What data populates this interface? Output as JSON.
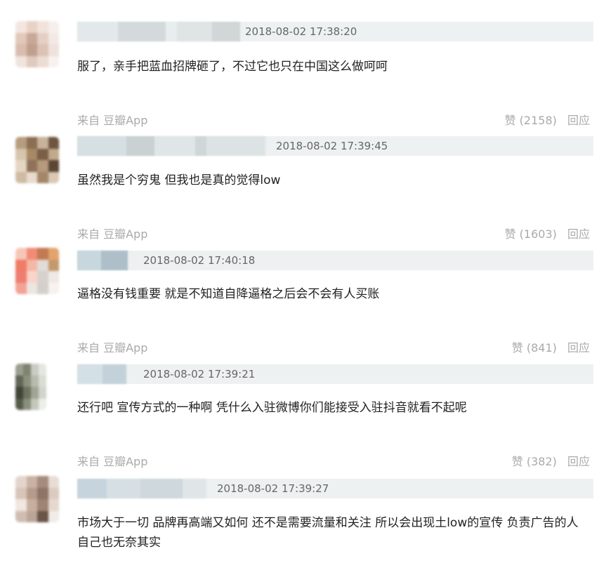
{
  "comments": [
    {
      "timestamp": "2018-08-02 17:38:20",
      "text": "服了，亲手把蓝血招牌砸了，不过它也只在中国这么做呵呵",
      "source": "来自 豆瓣App",
      "likes": "赞 (2158)",
      "reply": "回应"
    },
    {
      "timestamp": "2018-08-02 17:39:45",
      "text": "虽然我是个穷鬼 但我也是真的觉得low",
      "source": "来自 豆瓣App",
      "likes": "赞 (1603)",
      "reply": "回应"
    },
    {
      "timestamp": "2018-08-02 17:40:18",
      "text": "逼格没有钱重要 就是不知道自降逼格之后会不会有人买账",
      "source": "来自 豆瓣App",
      "likes": "赞 (841)",
      "reply": "回应"
    },
    {
      "timestamp": "2018-08-02 17:39:21",
      "text": "还行吧 宣传方式的一种啊 凭什么入驻微博你们能接受入驻抖音就看不起呢",
      "source": "来自 豆瓣App",
      "likes": "赞 (382)",
      "reply": "回应"
    },
    {
      "timestamp": "2018-08-02 17:39:27",
      "text": "市场大于一切 品牌再高端又如何 还不是需要流量和关注 所以会出现土low的宣传 负责广告的人自己也无奈其实"
    }
  ],
  "colors": {
    "header_bg": "#eef1f1",
    "text": "#222222",
    "muted": "#aaaaaa"
  }
}
